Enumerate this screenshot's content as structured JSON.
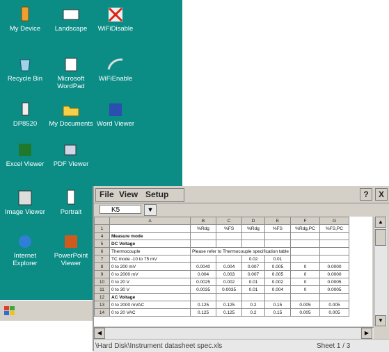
{
  "desktop": {
    "icons": [
      {
        "label": "My Device",
        "icon": "my-device-icon"
      },
      {
        "label": "Landscape",
        "icon": "landscape-icon"
      },
      {
        "label": "WiFiDisable",
        "icon": "wifi-disable-icon"
      },
      {
        "label": "Recycle Bin",
        "icon": "recycle-bin-icon"
      },
      {
        "label": "Microsoft WordPad",
        "icon": "wordpad-icon"
      },
      {
        "label": "WiFiEnable",
        "icon": "wifi-enable-icon"
      },
      {
        "label": "DP8520",
        "icon": "dp8520-shortcut-icon"
      },
      {
        "label": "My Documents",
        "icon": "my-documents-folder-icon"
      },
      {
        "label": "Word Viewer",
        "icon": "word-viewer-icon"
      },
      {
        "label": "Excel Viewer",
        "icon": "excel-viewer-icon"
      },
      {
        "label": "PDF Viewer",
        "icon": "pdf-viewer-icon"
      },
      {
        "label": "Image Viewer",
        "icon": "image-viewer-icon"
      },
      {
        "label": "Portrait",
        "icon": "portrait-icon"
      },
      {
        "label": "Internet Explorer",
        "icon": "internet-explorer-icon"
      },
      {
        "label": "PowerPoint Viewer",
        "icon": "powerpoint-viewer-icon"
      }
    ]
  },
  "window": {
    "menu": {
      "file": "File",
      "view": "View",
      "setup": "Setup"
    },
    "help_btn": "?",
    "close_btn": "X",
    "cell_ref": "K5",
    "dropdown_glyph": "▼",
    "status_path": "\\Hard Disk\\Instrument datasheet spec.xls",
    "status_sheet": "Sheet 1 / 3"
  },
  "sheet": {
    "columns": [
      "",
      "A",
      "B",
      "C",
      "D",
      "E",
      "F",
      "G"
    ],
    "rows": [
      [
        "1",
        "",
        "%Rdg",
        "%FS",
        "%Rdg",
        "%FS",
        "%Rdg,PC",
        "%FS,PC"
      ],
      [
        "4",
        "Measure mode",
        "",
        "",
        "",
        "",
        "",
        ""
      ],
      [
        "5",
        "DC Voltage",
        "",
        "",
        "",
        "",
        "",
        ""
      ],
      [
        "6",
        "Thermocouple",
        "Please refer to Thermocouple specification table",
        "",
        "",
        "",
        "",
        ""
      ],
      [
        "7",
        "TC mode -10 to 75 mV",
        "",
        "",
        "0.02",
        "0.01",
        "",
        ""
      ],
      [
        "8",
        "0 to 200 mV",
        "0.0040",
        "0.004",
        "0.007",
        "0.005",
        "0",
        "0.0000"
      ],
      [
        "9",
        "0 to 2000 mV",
        "0.004",
        "0.003",
        "0.007",
        "0.005",
        "0",
        "0.0000"
      ],
      [
        "10",
        "0 to 20 V",
        "0.0025",
        "0.002",
        "0.01",
        "0.002",
        "0",
        "0.0005"
      ],
      [
        "11",
        "0 to 30 V",
        "0.0035",
        "0.0035",
        "0.01",
        "0.004",
        "0",
        "0.0005"
      ],
      [
        "12",
        "AC Voltage",
        "",
        "",
        "",
        "",
        "",
        ""
      ],
      [
        "13",
        "0 to 2000 mVAC",
        "0.125",
        "0.125",
        "0.2",
        "0.15",
        "0.005",
        "0.005"
      ],
      [
        "14",
        "0 to 20 VAC",
        "0.125",
        "0.125",
        "0.2",
        "0.15",
        "0.005",
        "0.005"
      ]
    ],
    "bold_rows": [
      "4",
      "5",
      "12"
    ]
  }
}
